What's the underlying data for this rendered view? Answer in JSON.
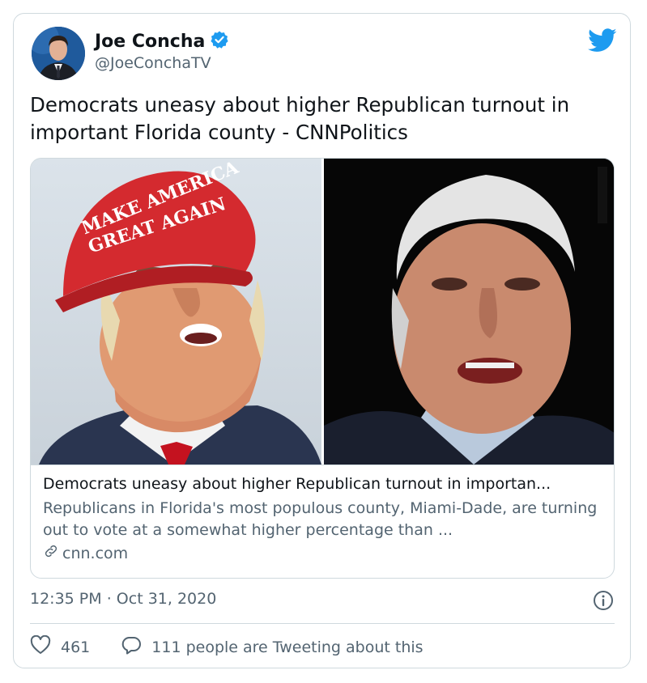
{
  "author": {
    "name": "Joe Concha",
    "handle": "@JoeConchaTV",
    "verified": true
  },
  "tweet": {
    "text": "Democrats uneasy about higher Republican turnout in important Florida county - CNNPolitics"
  },
  "link_card": {
    "image_left_hat_line1": "MAKE AMERICA",
    "image_left_hat_line2": "GREAT AGAIN",
    "title": "Democrats uneasy about higher Republican turnout in importan...",
    "description": "Republicans in Florida's most populous county, Miami-Dade, are turning out to vote at a somewhat higher percentage than ...",
    "domain": "cnn.com"
  },
  "meta": {
    "time": "12:35 PM",
    "separator": "·",
    "date": "Oct 31, 2020"
  },
  "actions": {
    "likes": "461",
    "conversation": "111 people are Tweeting about this"
  },
  "colors": {
    "twitter_blue": "#1d9bf0",
    "text": "#0f1419",
    "secondary": "#536471",
    "border": "#cfd9de",
    "hat_red": "#d42a2f"
  },
  "icons": [
    "verified-badge-icon",
    "twitter-bird-icon",
    "link-icon",
    "info-icon",
    "heart-icon",
    "reply-bubble-icon"
  ]
}
